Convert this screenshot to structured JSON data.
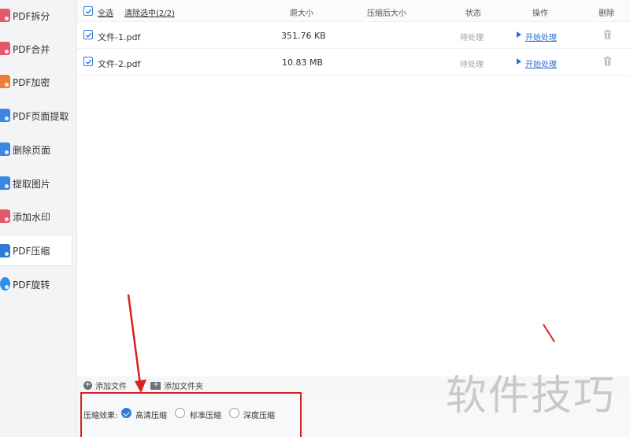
{
  "sidebar": {
    "items": [
      {
        "label": "PDF拆分",
        "icon": "pdf-split-icon",
        "color": "#e35a6a",
        "active": false
      },
      {
        "label": "PDF合并",
        "icon": "pdf-merge-icon",
        "color": "#e5566b",
        "active": false
      },
      {
        "label": "PDF加密",
        "icon": "pdf-encrypt-icon",
        "color": "#ee7d35",
        "active": false
      },
      {
        "label": "PDF页面提取",
        "icon": "page-extract-icon",
        "color": "#3b86e0",
        "active": false
      },
      {
        "label": "删除页面",
        "icon": "delete-page-icon",
        "color": "#3b86e0",
        "active": false
      },
      {
        "label": "提取图片",
        "icon": "extract-image-icon",
        "color": "#3b86e0",
        "active": false
      },
      {
        "label": "添加水印",
        "icon": "watermark-icon",
        "color": "#e5566b",
        "active": false
      },
      {
        "label": "PDF压缩",
        "icon": "pdf-compress-icon",
        "color": "#2f7bd8",
        "active": true
      },
      {
        "label": "PDF旋转",
        "icon": "pdf-rotate-icon",
        "color": "#2f8fe8",
        "active": false
      }
    ]
  },
  "header": {
    "select_all": "全选",
    "clear_selection": "清除选中(2/2)",
    "col_original_size": "原大小",
    "col_compressed_size": "压缩后大小",
    "col_status": "状态",
    "col_action": "操作",
    "col_delete": "删除"
  },
  "files": [
    {
      "name": "文件-1.pdf",
      "size": "351.76 KB",
      "compressed": "",
      "status": "待处理",
      "action": "开始处理",
      "checked": true
    },
    {
      "name": "文件-2.pdf",
      "size": "10.83 MB",
      "compressed": "",
      "status": "待处理",
      "action": "开始处理",
      "checked": true
    }
  ],
  "toolbar": {
    "add_file": "添加文件",
    "add_folder": "添加文件夹"
  },
  "compression": {
    "label": "压缩效果:",
    "options": [
      {
        "label": "高清压缩",
        "selected": true
      },
      {
        "label": "标准压缩",
        "selected": false
      },
      {
        "label": "深度压缩",
        "selected": false
      }
    ]
  },
  "watermark": "软件技巧",
  "colors": {
    "accent": "#2f7bd8",
    "link": "#2f6fd0",
    "annotation": "#d92020",
    "status_gray": "#9aa0a8"
  }
}
